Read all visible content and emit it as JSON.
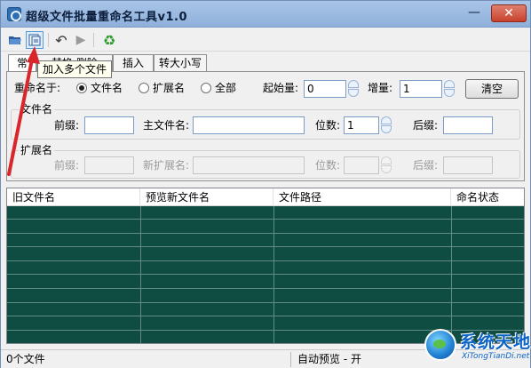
{
  "window": {
    "title": "超级文件批量重命名工具v1.0"
  },
  "toolbar": {
    "tooltip": "加入多个文件"
  },
  "tabs": [
    {
      "label": "常规",
      "visible": "常"
    },
    {
      "label": "替换 删除"
    },
    {
      "label": "插入"
    },
    {
      "label": "转大小写"
    }
  ],
  "rename_target": {
    "label": "重命名于:",
    "options": [
      {
        "label": "文件名",
        "selected": true
      },
      {
        "label": "扩展名",
        "selected": false
      },
      {
        "label": "全部",
        "selected": false
      }
    ]
  },
  "start": {
    "label": "起始量:",
    "value": "0"
  },
  "increment": {
    "label": "增量:",
    "value": "1"
  },
  "clear_label": "清空",
  "filename_group": {
    "title": "文件名",
    "prefix_label": "前缀:",
    "main_label": "主文件名:",
    "digits_label": "位数:",
    "digits_value": "1",
    "suffix_label": "后缀:"
  },
  "extension_group": {
    "title": "扩展名",
    "prefix_label": "前缀:",
    "new_ext_label": "新扩展名:",
    "digits_label": "位数:",
    "suffix_label": "后缀:"
  },
  "table": {
    "columns": [
      "旧文件名",
      "预览新文件名",
      "文件路径",
      "命名状态"
    ]
  },
  "status": {
    "file_count": "0个文件",
    "auto_preview": "自动预览 - 开"
  },
  "watermark": {
    "main": "系统天地",
    "sub": "XiTongTianDi.net"
  },
  "colors": {
    "table_bg": "#0f4d43",
    "arrow": "#d9262b"
  }
}
